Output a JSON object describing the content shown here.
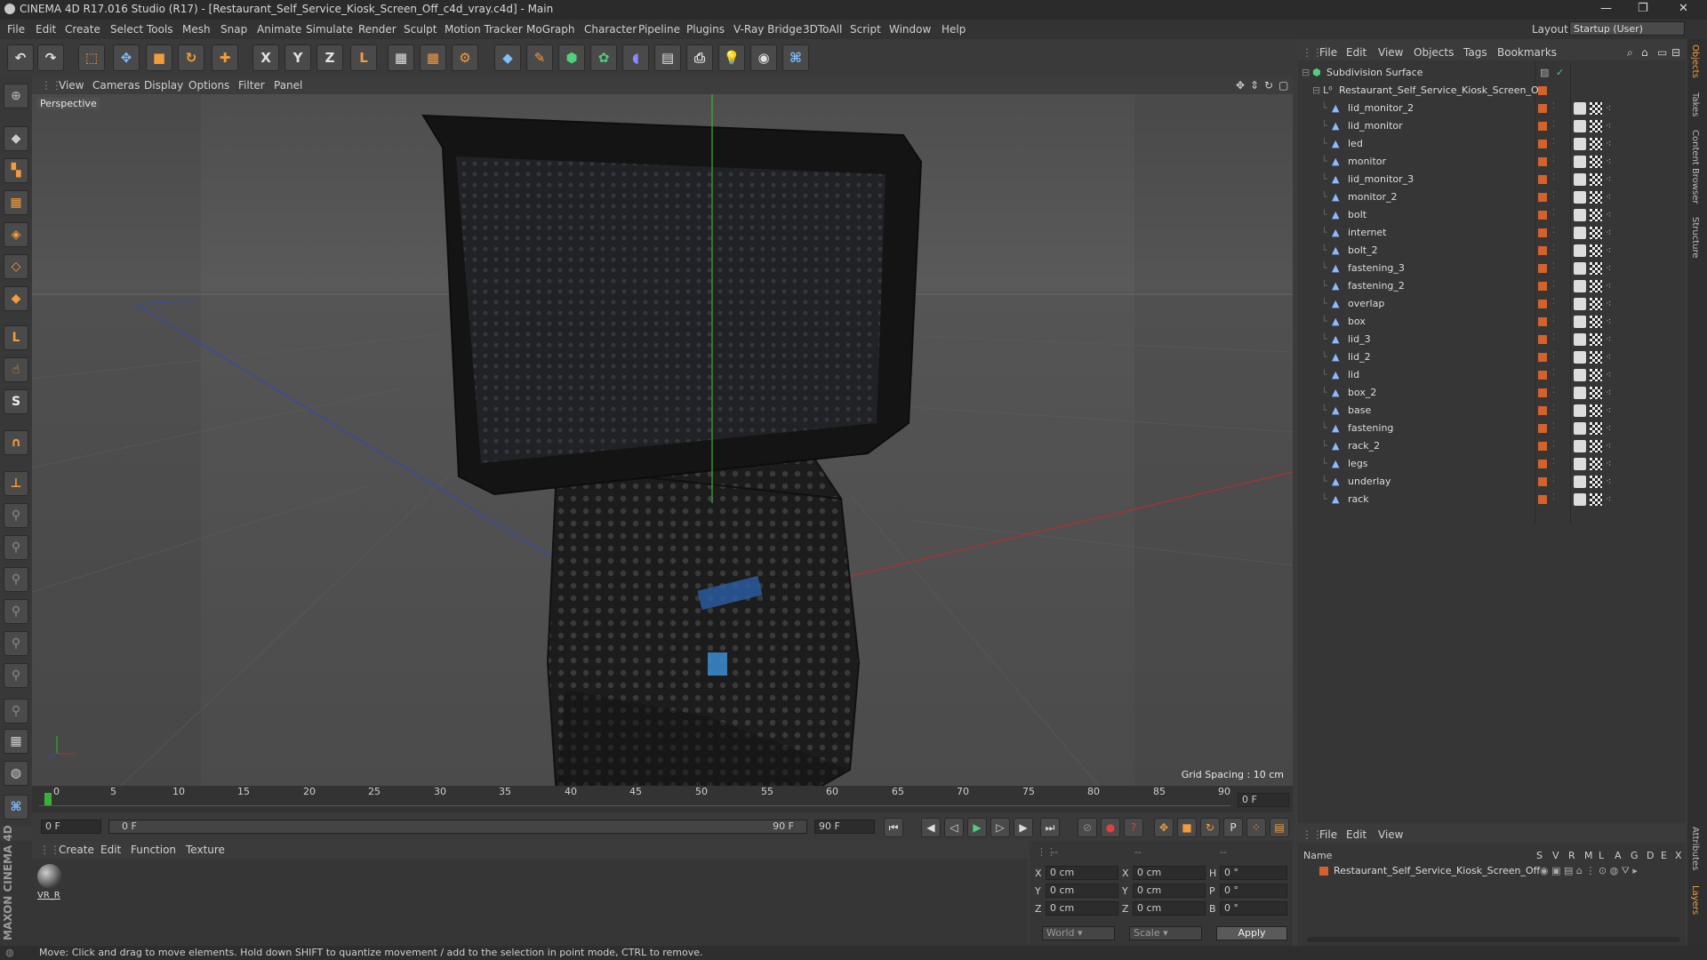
{
  "window": {
    "title": "CINEMA 4D R17.016 Studio (R17) - [Restaurant_Self_Service_Kiosk_Screen_Off_c4d_vray.c4d] - Main"
  },
  "menubar": {
    "items": [
      "File",
      "Edit",
      "Create",
      "Select",
      "Tools",
      "Mesh",
      "Snap",
      "Animate",
      "Simulate",
      "Render",
      "Sculpt",
      "Motion Tracker",
      "MoGraph",
      "Character",
      "Pipeline",
      "Plugins",
      "V-Ray Bridge",
      "3DToAll",
      "Script",
      "Window",
      "Help"
    ],
    "layout_label": "Layout:",
    "layout_value": "Startup (User)"
  },
  "viewport": {
    "menu": [
      "View",
      "Cameras",
      "Display",
      "Options",
      "Filter",
      "Panel"
    ],
    "camera_label": "Perspective",
    "grid_spacing": "Grid Spacing : 10 cm"
  },
  "timeline": {
    "ticks": [
      "0",
      "5",
      "10",
      "15",
      "20",
      "25",
      "30",
      "35",
      "40",
      "45",
      "50",
      "55",
      "60",
      "65",
      "70",
      "75",
      "80",
      "85",
      "90"
    ],
    "frame_right": "0 F",
    "current_frame": "0 F",
    "range_start": "0 F",
    "range_end": "90 F",
    "end_frame": "90 F"
  },
  "material_panel": {
    "menu": [
      "Create",
      "Edit",
      "Function",
      "Texture"
    ],
    "material_name": "VR_R"
  },
  "coords": {
    "rows": [
      {
        "a": "X",
        "av": "0 cm",
        "b": "X",
        "bv": "0 cm",
        "c": "H",
        "cv": "0 °"
      },
      {
        "a": "Y",
        "av": "0 cm",
        "b": "Y",
        "bv": "0 cm",
        "c": "P",
        "cv": "0 °"
      },
      {
        "a": "Z",
        "av": "0 cm",
        "b": "Z",
        "bv": "0 cm",
        "c": "B",
        "cv": "0 °"
      }
    ],
    "world": "World",
    "scale": "Scale",
    "apply": "Apply",
    "dashes": [
      "--",
      "--",
      "--"
    ]
  },
  "objects": {
    "menu": [
      "File",
      "Edit",
      "View",
      "Objects",
      "Tags",
      "Bookmarks"
    ],
    "root": "Subdivision Surface",
    "group": "Restaurant_Self_Service_Kiosk_Screen_Off",
    "items": [
      "lid_monitor_2",
      "lid_monitor",
      "led",
      "monitor",
      "lid_monitor_3",
      "monitor_2",
      "bolt",
      "internet",
      "bolt_2",
      "fastening_3",
      "fastening_2",
      "overlap",
      "box",
      "lid_3",
      "lid_2",
      "lid",
      "box_2",
      "base",
      "fastening",
      "rack_2",
      "legs",
      "underlay",
      "rack"
    ]
  },
  "layers": {
    "menu": [
      "File",
      "Edit",
      "View"
    ],
    "header_name": "Name",
    "header_cols": [
      "S",
      "V",
      "R",
      "M",
      "L",
      "A",
      "G",
      "D",
      "E",
      "X"
    ],
    "row_name": "Restaurant_Self_Service_Kiosk_Screen_Off"
  },
  "side_tabs": [
    "Objects",
    "Takes",
    "Content Browser",
    "Structure",
    "Attributes",
    "Layers"
  ],
  "brand": "MAXON CINEMA 4D",
  "status": "Move: Click and drag to move elements. Hold down SHIFT to quantize movement / add to the selection in point mode, CTRL to remove.",
  "colors": {
    "accent": "#f39c3c",
    "layer": "#d4622a",
    "bg": "#3b3b3b"
  }
}
